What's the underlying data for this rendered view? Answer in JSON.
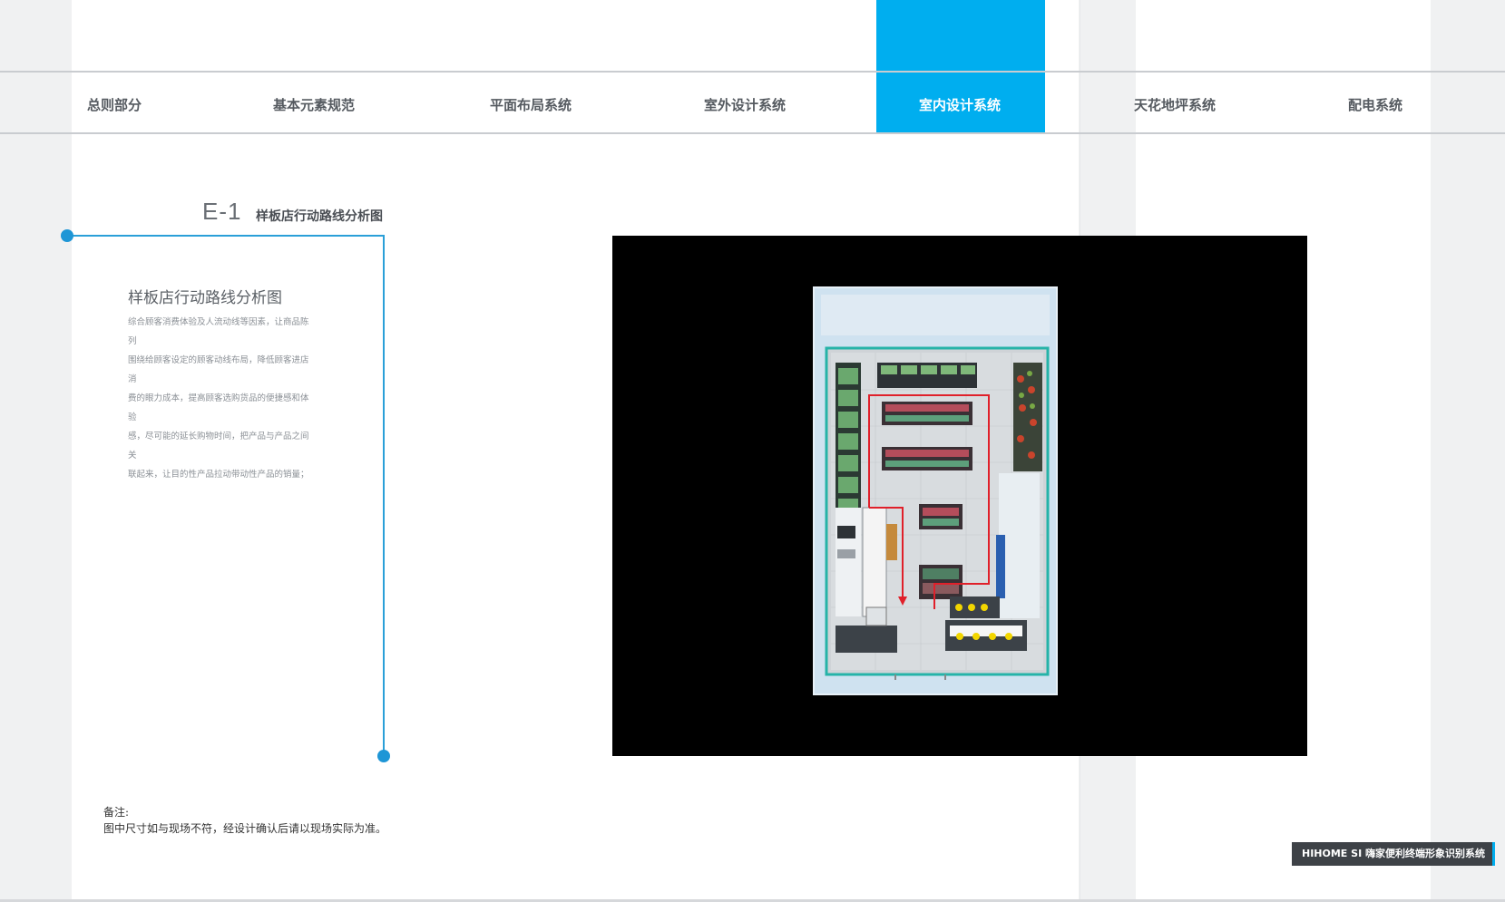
{
  "nav": {
    "items": [
      "总则部分",
      "基本元素规范",
      "平面布局系统",
      "室外设计系统",
      "室内设计系统",
      "天花地坪系统",
      "配电系统"
    ],
    "active_index": 4
  },
  "section": {
    "code": "E-1",
    "title": "样板店行动路线分析图"
  },
  "description": {
    "title": "样板店行动路线分析图",
    "lines": [
      "综合顾客消费体验及人流动线等因素，让商品陈列",
      "围绕给顾客设定的顾客动线布局，降低顾客进店消",
      "费的眼力成本，提高顾客选购货品的便捷感和体验",
      "感，尽可能的延长购物时间，把产品与产品之间关",
      "联起来，让目的性产品拉动带动性产品的销量；"
    ]
  },
  "note": {
    "label": "备注:",
    "text": "图中尺寸如与现场不符，经设计确认后请以现场实际为准。"
  },
  "footer": {
    "brand": "HIHOME SI  嗨家便利终端形象识别系统"
  },
  "colors": {
    "accent": "#00aeef",
    "bracket": "#2a9fd8",
    "route": "#e0202a",
    "frame_bg": "#000000"
  }
}
